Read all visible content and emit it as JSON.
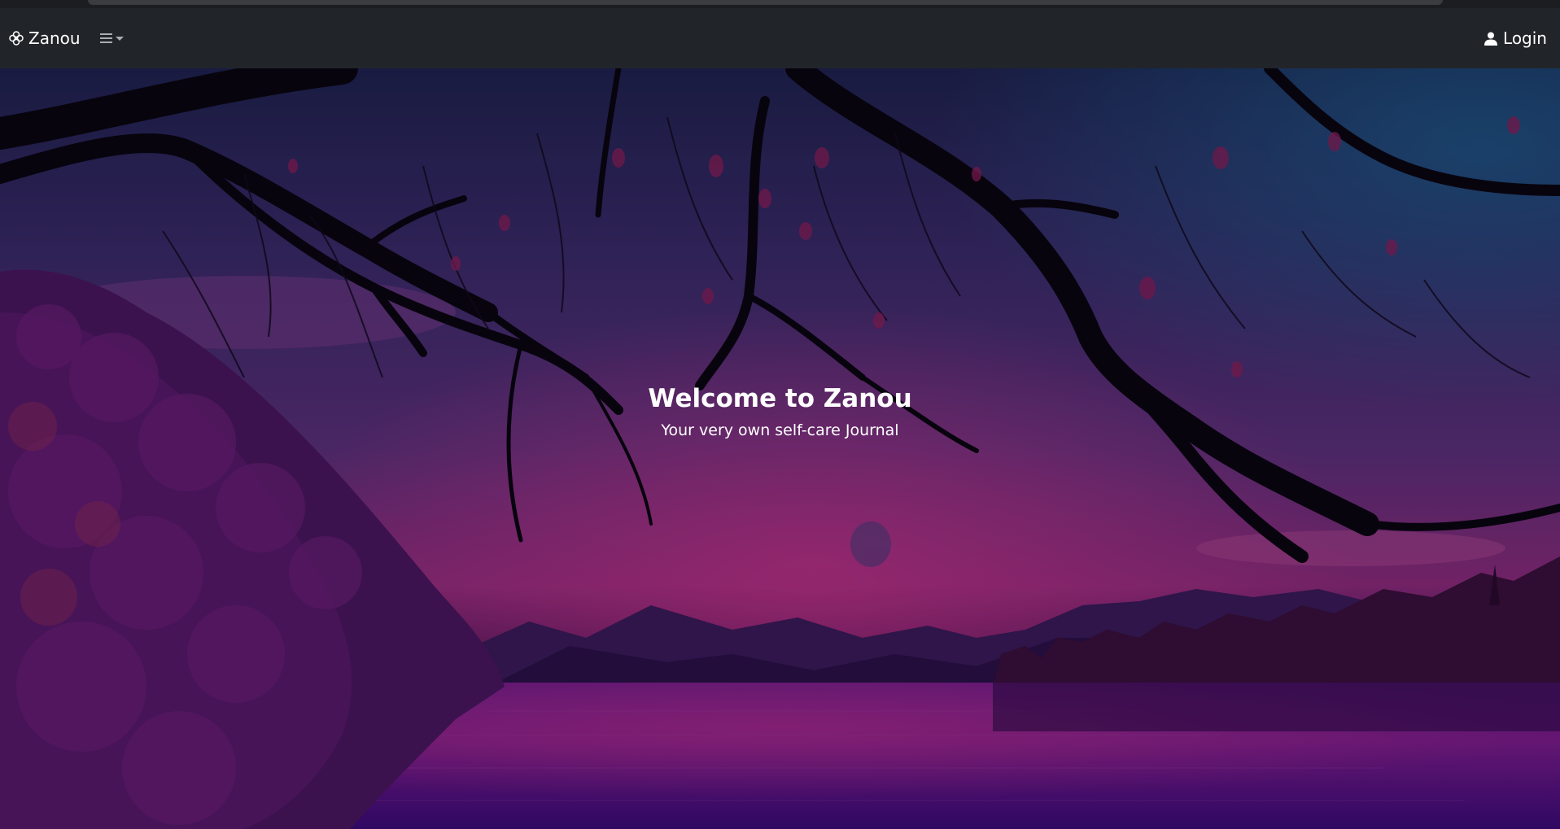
{
  "navbar": {
    "brand": "Zanou",
    "login_label": "Login"
  },
  "hero": {
    "title": "Welcome to Zanou",
    "subtitle": "Your very own self-care Journal"
  },
  "icons": {
    "brand": "flower-icon",
    "menu": "hamburger-icon",
    "menu_caret": "caret-down-icon",
    "login": "user-icon"
  },
  "colors": {
    "navbar": "#212529",
    "text": "#ffffff",
    "sky_top": "#2a1e4a",
    "sky_glow": "#b0307c",
    "water": "#3a0a6a"
  }
}
